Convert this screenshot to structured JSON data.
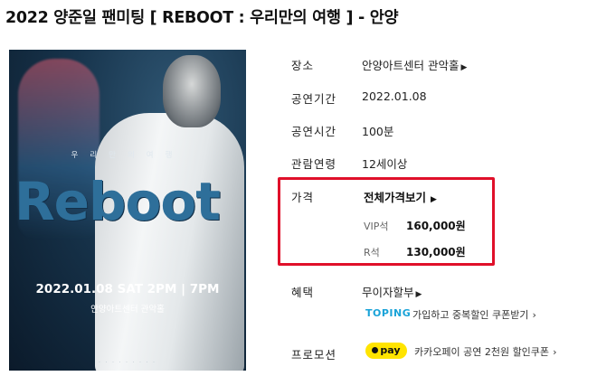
{
  "title": "2022 양준일 팬미팅 [ REBOOT : 우리만의 여행 ] - 안양",
  "poster": {
    "subtitle": "우리만의여행",
    "logo": "Reboot",
    "date": "2022.01.08 SAT 2PM | 7PM",
    "venue": "안양아트센터 관악홀"
  },
  "info": {
    "venue": {
      "label": "장소",
      "value": "안양아트센터 관악홀"
    },
    "period": {
      "label": "공연기간",
      "value": "2022.01.08"
    },
    "duration": {
      "label": "공연시간",
      "value": "100분"
    },
    "age": {
      "label": "관람연령",
      "value": "12세이상"
    },
    "price": {
      "label": "가격",
      "toggle": "전체가격보기",
      "grades": [
        {
          "grade": "VIP석",
          "amount": "160,000원"
        },
        {
          "grade": "R석",
          "amount": "130,000원"
        }
      ]
    },
    "benefit": {
      "label": "혜택",
      "value": "무이자할부",
      "toping_logo": "TOPING",
      "toping_text": "가입하고 중복할인 쿠폰받기"
    },
    "promotion": {
      "label": "프로모션",
      "badge": "pay",
      "text": "카카오페이 공연 2천원 할인쿠폰"
    }
  },
  "colors": {
    "highlight_border": "#e0102a",
    "kakaopay": "#ffe400",
    "toping": "#1aa3d8"
  }
}
